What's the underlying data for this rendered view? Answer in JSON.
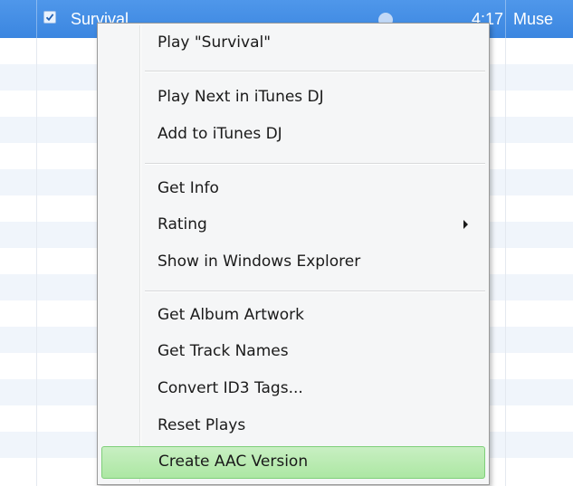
{
  "track": {
    "name": "Survival",
    "time": "4:17",
    "artist": "Muse",
    "checked": true
  },
  "context_menu": {
    "items": [
      {
        "id": "play",
        "label": "Play \"Survival\""
      },
      {
        "id": "play-next-itunes-dj",
        "label": "Play Next in iTunes DJ"
      },
      {
        "id": "add-to-itunes-dj",
        "label": "Add to iTunes DJ"
      },
      {
        "id": "get-info",
        "label": "Get Info"
      },
      {
        "id": "rating",
        "label": "Rating",
        "has_submenu": true
      },
      {
        "id": "show-in-windows-explorer",
        "label": "Show in Windows Explorer"
      },
      {
        "id": "get-album-artwork",
        "label": "Get Album Artwork"
      },
      {
        "id": "get-track-names",
        "label": "Get Track Names"
      },
      {
        "id": "convert-id3-tags",
        "label": "Convert ID3 Tags..."
      },
      {
        "id": "reset-plays",
        "label": "Reset Plays"
      },
      {
        "id": "create-aac-version",
        "label": "Create AAC Version",
        "highlighted": true
      }
    ]
  },
  "colors": {
    "selection": "#3b86e0",
    "menu_background": "#f5f6f7",
    "highlight": "#ace7a3",
    "highlight_border": "#7fcf7a",
    "alt_row": "#f0f5fb"
  },
  "icons": {
    "checkbox": "check-icon",
    "submenu": "chevron-right-icon",
    "status": "status-circle-icon"
  }
}
